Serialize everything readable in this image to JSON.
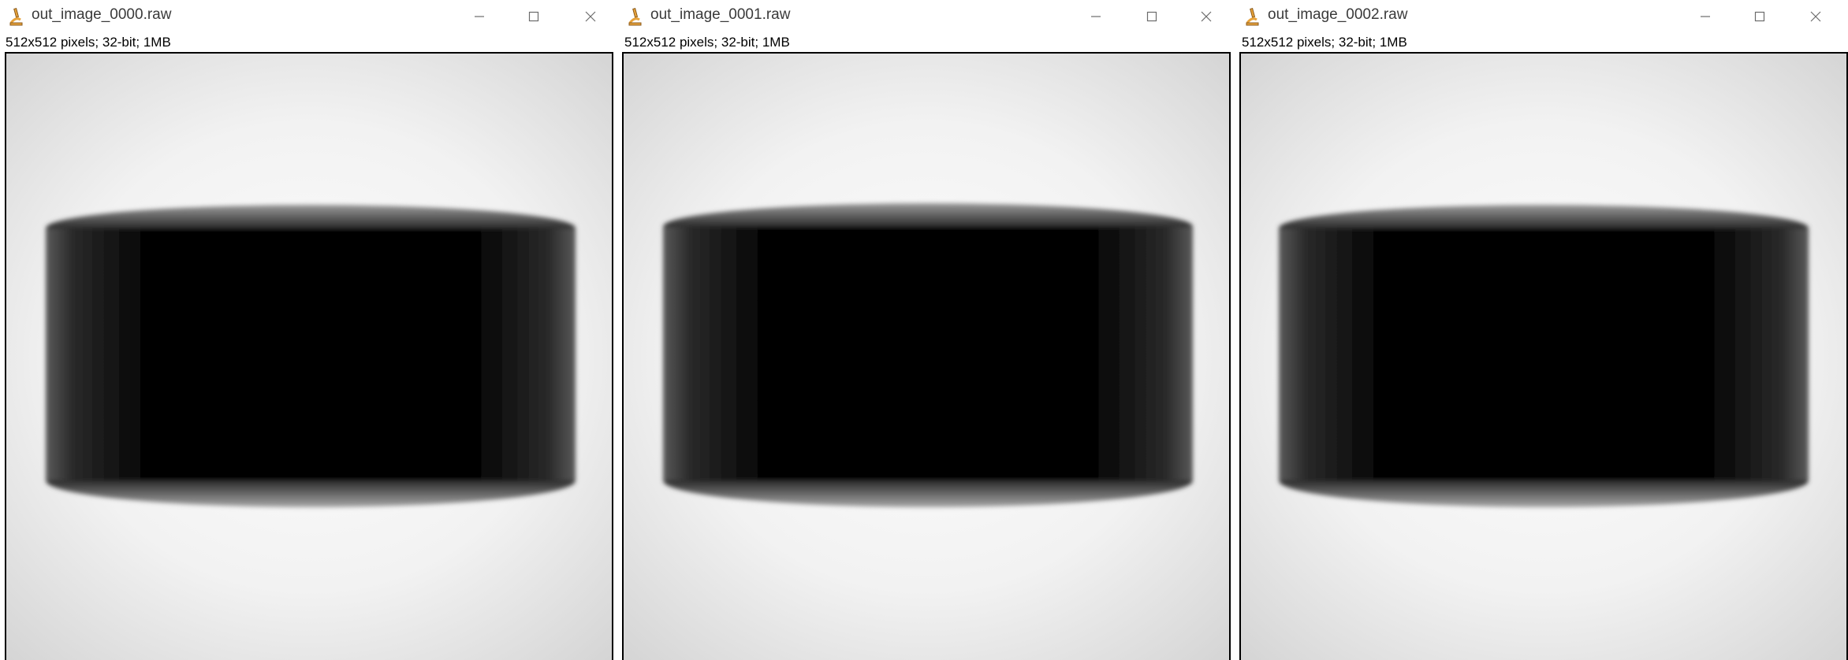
{
  "windows": [
    {
      "title": "out_image_0000.raw",
      "info": "512x512 pixels; 32-bit; 1MB",
      "icon": "imagej-microscope-icon",
      "controls": {
        "minimize": "minimize-icon",
        "maximize": "maximize-icon",
        "close": "close-icon"
      }
    },
    {
      "title": "out_image_0001.raw",
      "info": "512x512 pixels; 32-bit; 1MB",
      "icon": "imagej-microscope-icon",
      "controls": {
        "minimize": "minimize-icon",
        "maximize": "maximize-icon",
        "close": "close-icon"
      }
    },
    {
      "title": "out_image_0002.raw",
      "info": "512x512 pixels; 32-bit; 1MB",
      "icon": "imagej-microscope-icon",
      "controls": {
        "minimize": "minimize-icon",
        "maximize": "maximize-icon",
        "close": "close-icon"
      }
    }
  ],
  "colors": {
    "icon_orange": "#e8a33a",
    "icon_brown": "#8a5a1c",
    "control_glyph": "#6b6b6b",
    "image_background": "#eeeeee",
    "cylinder": "#000000"
  }
}
